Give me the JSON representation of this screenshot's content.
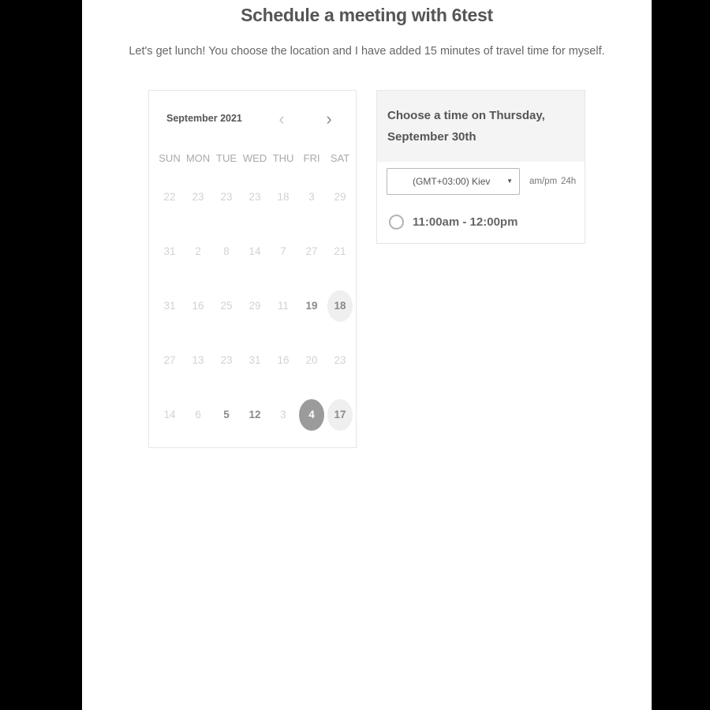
{
  "header": {
    "title": "Schedule a meeting with 6test",
    "subtitle": "Let's get lunch! You choose the location and I have added 15 minutes of travel time for myself."
  },
  "calendar": {
    "month_label": "September 2021",
    "prev_icon": "chevron-left-icon",
    "next_icon": "chevron-right-icon",
    "prev_glyph": "‹",
    "next_glyph": "›",
    "weekdays": [
      "SUN",
      "MON",
      "TUE",
      "WED",
      "THU",
      "FRI",
      "SAT"
    ],
    "weeks": [
      [
        {
          "label": "22",
          "state": "disabled"
        },
        {
          "label": "23",
          "state": "disabled"
        },
        {
          "label": "23",
          "state": "disabled"
        },
        {
          "label": "23",
          "state": "disabled"
        },
        {
          "label": "18",
          "state": "disabled"
        },
        {
          "label": "3",
          "state": "disabled"
        },
        {
          "label": "29",
          "state": "disabled"
        }
      ],
      [
        {
          "label": "31",
          "state": "disabled"
        },
        {
          "label": "2",
          "state": "disabled"
        },
        {
          "label": "8",
          "state": "disabled"
        },
        {
          "label": "14",
          "state": "disabled"
        },
        {
          "label": "7",
          "state": "disabled"
        },
        {
          "label": "27",
          "state": "disabled"
        },
        {
          "label": "21",
          "state": "disabled"
        }
      ],
      [
        {
          "label": "31",
          "state": "disabled"
        },
        {
          "label": "16",
          "state": "disabled"
        },
        {
          "label": "25",
          "state": "disabled"
        },
        {
          "label": "29",
          "state": "disabled"
        },
        {
          "label": "11",
          "state": "disabled"
        },
        {
          "label": "19",
          "state": "available"
        },
        {
          "label": "18",
          "state": "highlight"
        }
      ],
      [
        {
          "label": "27",
          "state": "disabled"
        },
        {
          "label": "13",
          "state": "disabled"
        },
        {
          "label": "23",
          "state": "disabled"
        },
        {
          "label": "31",
          "state": "disabled"
        },
        {
          "label": "16",
          "state": "disabled"
        },
        {
          "label": "20",
          "state": "disabled"
        },
        {
          "label": "23",
          "state": "disabled"
        }
      ],
      [
        {
          "label": "14",
          "state": "disabled"
        },
        {
          "label": "6",
          "state": "disabled"
        },
        {
          "label": "5",
          "state": "available"
        },
        {
          "label": "12",
          "state": "available"
        },
        {
          "label": "3",
          "state": "disabled"
        },
        {
          "label": "4",
          "state": "selected"
        },
        {
          "label": "17",
          "state": "highlight"
        }
      ]
    ]
  },
  "time_panel": {
    "heading": "Choose a time on Thursday, September 30th",
    "timezone_value": "(GMT+03:00) Kiev",
    "timezone_caret": "▼",
    "format_ampm": "am/pm",
    "format_24h": "24h",
    "slots": [
      {
        "label": "11:00am - 12:00pm"
      }
    ]
  },
  "colors": {
    "selected_day_bg": "#9b9b9b",
    "highlight_day_bg": "#efefef",
    "panel_header_bg": "#f4f4f4",
    "title_text": "#555555"
  }
}
